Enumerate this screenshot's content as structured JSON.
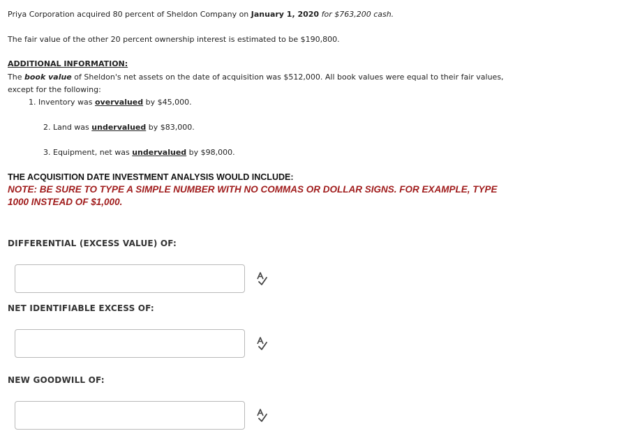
{
  "intro": {
    "p1_start": "Priya Corporation acquired 80 percent of Sheldon Company on ",
    "p1_date": "January 1, 2020",
    "p1_end": " for $763,200 cash.",
    "p2": "The fair value of the other 20 percent ownership interest is estimated to be $190,800."
  },
  "additional_info": {
    "heading": "ADDITIONAL INFORMATION:",
    "line1_start": "The ",
    "line1_bv": "book value",
    "line1_end": " of Sheldon's net assets on the date of acquisition was $512,000.  All book values were equal to their fair values,",
    "line2": "except for the following:",
    "items": [
      {
        "prefix": "1. Inventory was ",
        "emph": "overvalued",
        "suffix": " by $45,000."
      },
      {
        "prefix": "2. Land was ",
        "emph": "undervalued",
        "suffix": " by $83,000."
      },
      {
        "prefix": "3. Equipment, net was ",
        "emph": "undervalued",
        "suffix": " by $98,000."
      }
    ]
  },
  "analysis": {
    "heading": "THE ACQUISITION DATE INVESTMENT ANALYSIS WOULD INCLUDE:",
    "note_line1": "NOTE: BE SURE TO TYPE A SIMPLE NUMBER WITH NO COMMAS OR DOLLAR SIGNS. FOR EXAMPLE, TYPE",
    "note_line2": "1000 INSTEAD OF $1,000."
  },
  "questions": [
    {
      "label": "DIFFERENTIAL (EXCESS VALUE) OF:",
      "value": "",
      "icon": "spell-check-icon"
    },
    {
      "label": "NET IDENTIFIABLE EXCESS OF:",
      "value": "",
      "icon": "spell-check-icon"
    },
    {
      "label": "NEW GOODWILL OF:",
      "value": "",
      "icon": "spell-check-icon"
    }
  ]
}
